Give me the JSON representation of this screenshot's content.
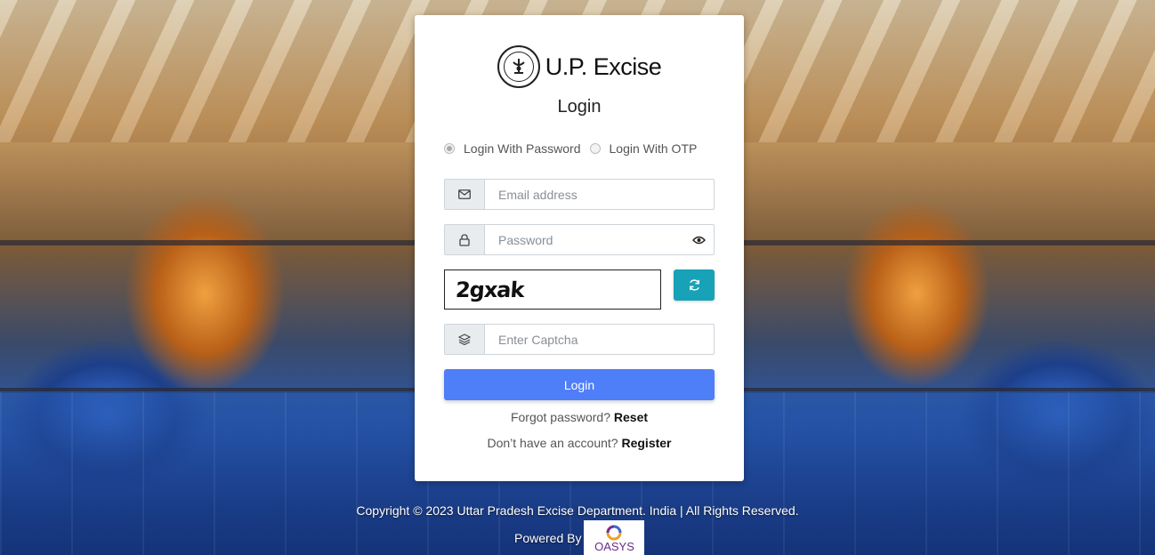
{
  "brand": {
    "name": "U.P. Excise"
  },
  "form": {
    "title": "Login",
    "login_modes": [
      {
        "label": "Login With Password",
        "checked": true
      },
      {
        "label": "Login With OTP",
        "checked": false
      }
    ],
    "email": {
      "placeholder": "Email address",
      "value": "",
      "icon": "envelope-icon"
    },
    "password": {
      "placeholder": "Password",
      "value": "",
      "icon": "lock-icon",
      "toggle_icon": "eye-icon"
    },
    "captcha": {
      "text": "2gxak",
      "refresh_icon": "refresh-icon"
    },
    "captcha_input": {
      "placeholder": "Enter Captcha",
      "value": "",
      "icon": "layers-icon"
    },
    "submit_label": "Login",
    "forgot": {
      "prompt": "Forgot password?",
      "link": "Reset"
    },
    "register": {
      "prompt": "Don’t have an account?",
      "link": "Register"
    }
  },
  "footer": {
    "copyright": "Copyright © 2023 Uttar Pradesh Excise Department. India | All Rights Reserved.",
    "powered_by": "Powered By",
    "vendor": "OASYS"
  },
  "colors": {
    "primary_button": "#4e7ef8",
    "refresh_button": "#17a2b8",
    "card": "#ffffff"
  }
}
